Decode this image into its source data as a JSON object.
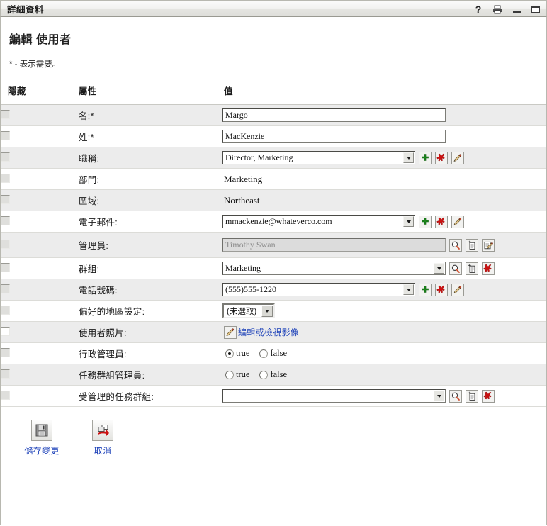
{
  "window": {
    "title": "詳細資料",
    "controls": {
      "help": "?",
      "print": "print-icon",
      "minimize": "_",
      "maximize": "maximize-icon"
    }
  },
  "page": {
    "title": "編輯 使用者",
    "required_note": "* - 表示需要。"
  },
  "table": {
    "headers": {
      "hide": "隱藏",
      "attribute": "屬性",
      "value": "值"
    },
    "rows": [
      {
        "label": "名:*",
        "type": "text",
        "value": "Margo",
        "hide_checked": false,
        "stripe": true
      },
      {
        "label": "姓:*",
        "type": "text",
        "value": "MacKenzie",
        "hide_checked": false,
        "stripe": false
      },
      {
        "label": "職稱:",
        "type": "combo",
        "value": "Director, Marketing",
        "actions": [
          "add-icon",
          "delete-icon",
          "edit-icon"
        ],
        "hide_checked": false,
        "stripe": true
      },
      {
        "label": "部門:",
        "type": "static",
        "value": "Marketing",
        "hide_checked": false,
        "stripe": false
      },
      {
        "label": "區域:",
        "type": "static",
        "value": "Northeast",
        "hide_checked": false,
        "stripe": true
      },
      {
        "label": "電子郵件:",
        "type": "combo",
        "value": "mmackenzie@whateverco.com",
        "actions": [
          "add-icon",
          "delete-icon",
          "edit-icon"
        ],
        "hide_checked": false,
        "stripe": false
      },
      {
        "label": "管理員:",
        "type": "text-disabled",
        "value": "Timothy Swan",
        "actions": [
          "search-icon",
          "new-object-icon",
          "edit-object-icon"
        ],
        "hide_checked": false,
        "stripe": true
      },
      {
        "label": "群組:",
        "type": "combo",
        "value": "Marketing",
        "actions": [
          "search-icon",
          "new-object-icon",
          "delete-icon"
        ],
        "hide_checked": false,
        "stripe": false
      },
      {
        "label": "電話號碼:",
        "type": "combo",
        "value": "(555)555-1220",
        "actions": [
          "add-icon",
          "delete-icon",
          "edit-icon"
        ],
        "hide_checked": false,
        "stripe": true
      },
      {
        "label": "偏好的地區設定:",
        "type": "select",
        "value": "(未選取)",
        "hide_checked": false,
        "stripe": false
      },
      {
        "label": "使用者照片:",
        "type": "link",
        "value": "編輯或檢視影像",
        "hide_checked": false,
        "stripe": true
      },
      {
        "label": "行政管理員:",
        "type": "radio",
        "options": [
          "true",
          "false"
        ],
        "selected": "true",
        "hide_checked": false,
        "stripe": false
      },
      {
        "label": "任務群組管理員:",
        "type": "radio",
        "options": [
          "true",
          "false"
        ],
        "selected": "",
        "hide_checked": false,
        "stripe": true
      },
      {
        "label": "受管理的任務群組:",
        "type": "combo",
        "value": "",
        "actions": [
          "search-icon",
          "new-object-icon",
          "delete-icon"
        ],
        "hide_checked": false,
        "stripe": false
      }
    ]
  },
  "actions": {
    "save": {
      "label": "儲存變更",
      "icon": "save-icon"
    },
    "cancel": {
      "label": "取消",
      "icon": "cancel-icon"
    }
  },
  "colors": {
    "link": "#1a3fb8",
    "stripe": "#ececec",
    "accent_green": "#1f8a1f",
    "accent_red": "#cc1111"
  }
}
